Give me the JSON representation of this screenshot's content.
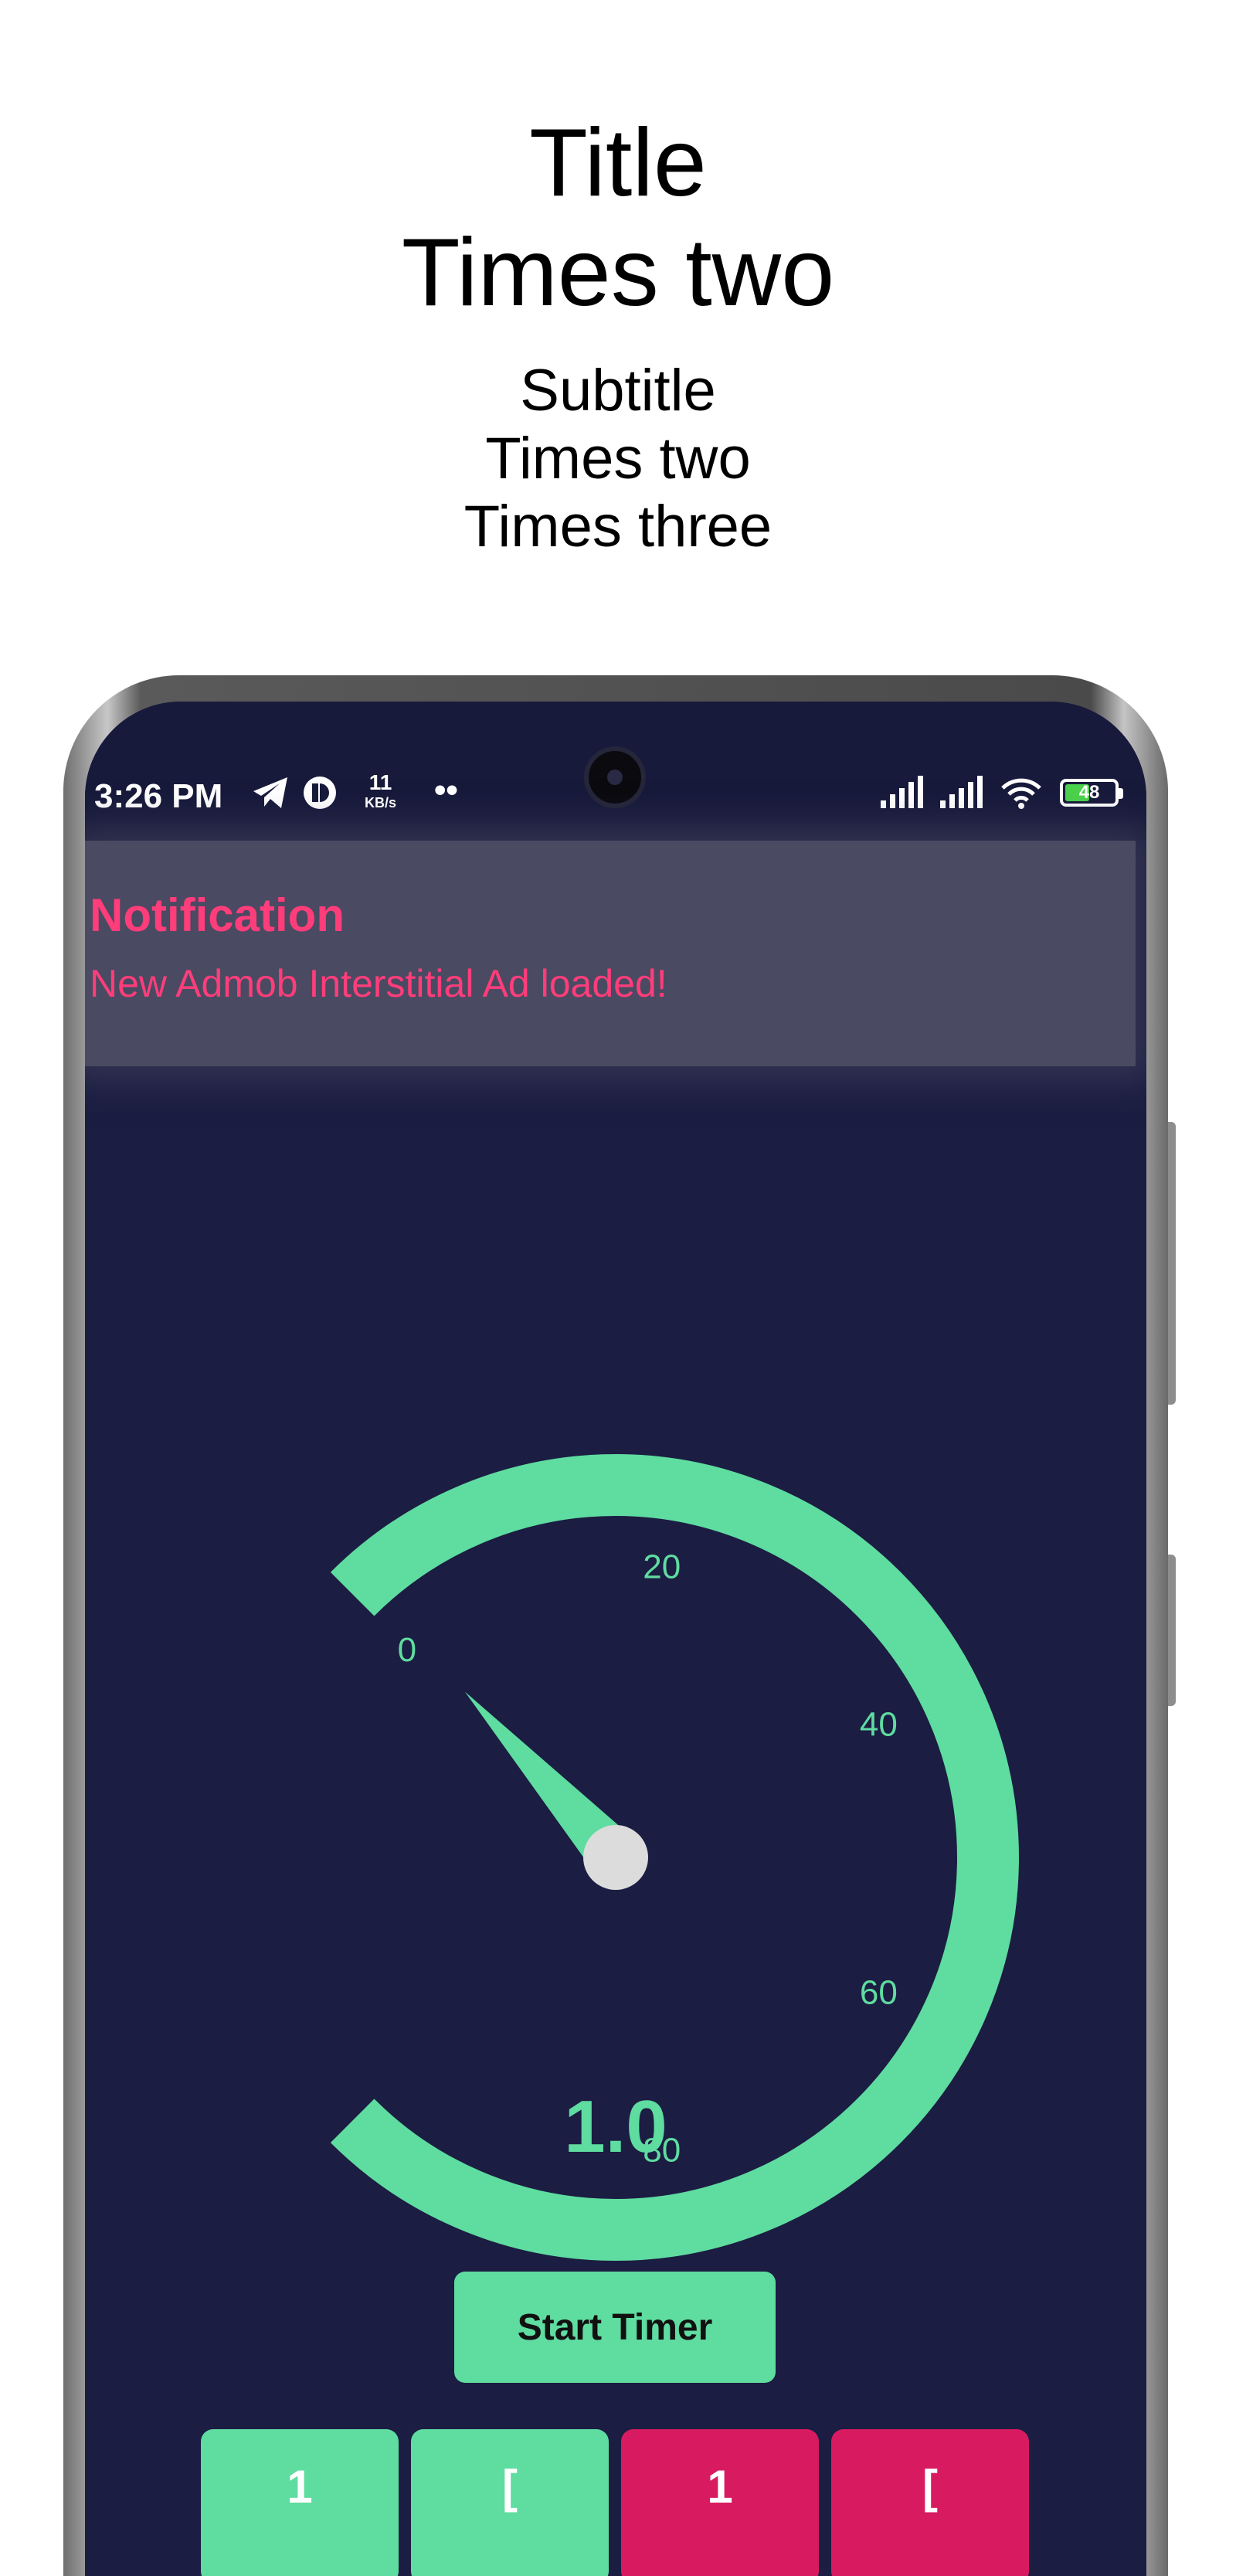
{
  "header": {
    "title_line1": "Title",
    "title_line2": "Times two",
    "subtitle_line1": "Subtitle",
    "subtitle_line2": "Times two",
    "subtitle_line3": "Times three"
  },
  "status_bar": {
    "time": "3:26 PM",
    "icons": [
      "telegram-icon",
      "app-icon"
    ],
    "speed_value": "11",
    "speed_unit": "KB/s",
    "more": "••",
    "battery": "48"
  },
  "notification": {
    "title": "Notification",
    "message": "New Admob Interstitial Ad loaded!"
  },
  "gauge": {
    "min": 0,
    "max": 100,
    "ticks": [
      "0",
      "20",
      "40",
      "60",
      "80"
    ],
    "value": 1.0,
    "value_label": "1.0",
    "arc_color": "#5fdca0",
    "needle_hub_color": "#dcdcdc",
    "background": "#1b1d42"
  },
  "controls": {
    "start_label": "Start Timer"
  },
  "bottom_buttons": [
    {
      "color": "#5fdca0",
      "label": "1"
    },
    {
      "color": "#5fdca0",
      "label": "["
    },
    {
      "color": "#d81b60",
      "label": "1"
    },
    {
      "color": "#d81b60",
      "label": "["
    }
  ],
  "colors": {
    "accent": "#5fdca0",
    "notification_text": "#ff3d7a"
  }
}
